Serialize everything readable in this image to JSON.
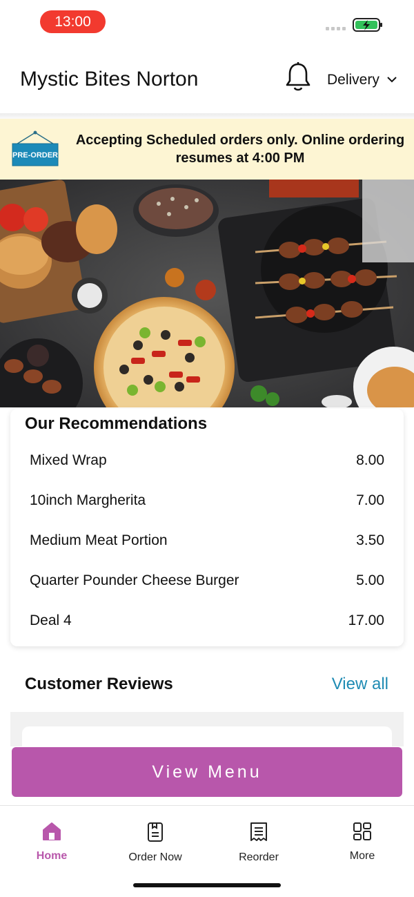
{
  "status_bar": {
    "time": "13:00"
  },
  "header": {
    "title": "Mystic Bites Norton",
    "mode": "Delivery"
  },
  "notice": {
    "badge": "PRE-ORDER",
    "text": "Accepting Scheduled orders only. Online ordering resumes at 4:00 PM"
  },
  "recommendations": {
    "title": "Our Recommendations",
    "items": [
      {
        "name": "Mixed Wrap",
        "price": "8.00"
      },
      {
        "name": "10inch Margherita",
        "price": "7.00"
      },
      {
        "name": "Medium Meat Portion",
        "price": "3.50"
      },
      {
        "name": "Quarter Pounder Cheese Burger",
        "price": "5.00"
      },
      {
        "name": "Deal 4",
        "price": "17.00"
      }
    ]
  },
  "reviews": {
    "title": "Customer Reviews",
    "view_all": "View all"
  },
  "view_menu": "View Menu",
  "tabs": [
    {
      "label": "Home",
      "icon": "home-icon",
      "active": true
    },
    {
      "label": "Order Now",
      "icon": "order-icon",
      "active": false
    },
    {
      "label": "Reorder",
      "icon": "receipt-icon",
      "active": false
    },
    {
      "label": "More",
      "icon": "grid-icon",
      "active": false
    }
  ],
  "colors": {
    "accent": "#b857ab",
    "link": "#1f8bb3",
    "notice_bg": "#fdf5d3",
    "time_pill": "#f23a2f"
  }
}
